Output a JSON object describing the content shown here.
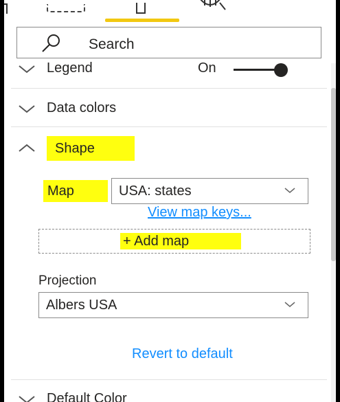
{
  "search": {
    "placeholder": "Search"
  },
  "sections": {
    "legend": {
      "label": "Legend",
      "toggle_text": "On"
    },
    "data_colors": {
      "label": "Data colors"
    },
    "shape": {
      "label": "Shape",
      "map_label": "Map",
      "map_value": "USA: states",
      "view_keys_link": "View map keys...",
      "add_map_label": "+ Add map",
      "projection_label": "Projection",
      "projection_value": "Albers USA",
      "revert_label": "Revert to default"
    },
    "default_color": {
      "label": "Default Color"
    }
  },
  "colors": {
    "highlight": "#ffff0f",
    "accent": "#f2c811",
    "link": "#118dff"
  },
  "icons": [
    "fields-icon",
    "format-paintbrush-icon",
    "analytics-icon",
    "search-icon",
    "chevron-down-icon",
    "chevron-up-icon"
  ]
}
